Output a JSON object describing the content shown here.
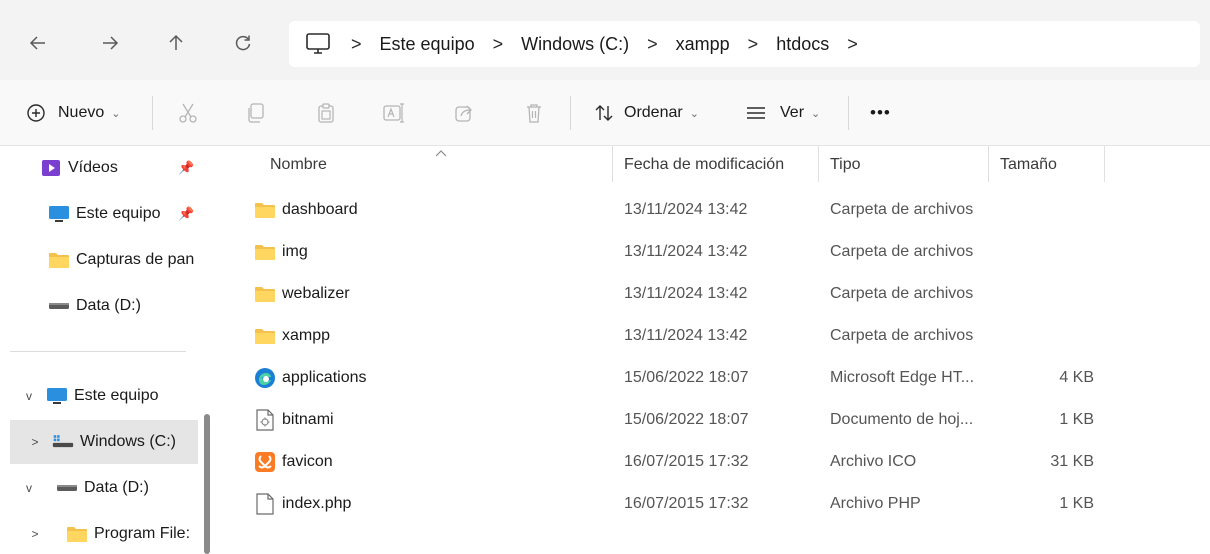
{
  "address": {
    "crumbs": [
      "Este equipo",
      "Windows (C:)",
      "xampp",
      "htdocs"
    ],
    "separator": ">"
  },
  "toolbar": {
    "new_label": "Nuevo",
    "sort_label": "Ordenar",
    "view_label": "Ver",
    "more_label": "•••"
  },
  "sidebar": {
    "quick": [
      {
        "label": "Vídeos",
        "icon": "videos-icon"
      },
      {
        "label": "Este equipo",
        "icon": "computer-icon"
      },
      {
        "label": "Capturas de pan",
        "icon": "folder-icon"
      },
      {
        "label": "Data (D:)",
        "icon": "drive-icon"
      }
    ],
    "tree": [
      {
        "label": "Este equipo",
        "expander": "v"
      },
      {
        "label": "Windows (C:)",
        "expander": ">"
      },
      {
        "label": "Data (D:)",
        "expander": "v"
      },
      {
        "label": "Program File:",
        "expander": ">"
      }
    ]
  },
  "columns": {
    "name": "Nombre",
    "date": "Fecha de modificación",
    "type": "Tipo",
    "size": "Tamaño"
  },
  "files": [
    {
      "name": "dashboard",
      "date": "13/11/2024 13:42",
      "type": "Carpeta de archivos",
      "size": "",
      "icon": "folder-icon"
    },
    {
      "name": "img",
      "date": "13/11/2024 13:42",
      "type": "Carpeta de archivos",
      "size": "",
      "icon": "folder-icon"
    },
    {
      "name": "webalizer",
      "date": "13/11/2024 13:42",
      "type": "Carpeta de archivos",
      "size": "",
      "icon": "folder-icon"
    },
    {
      "name": "xampp",
      "date": "13/11/2024 13:42",
      "type": "Carpeta de archivos",
      "size": "",
      "icon": "folder-icon"
    },
    {
      "name": "applications",
      "date": "15/06/2022 18:07",
      "type": "Microsoft Edge HT...",
      "size": "4 KB",
      "icon": "edge-icon"
    },
    {
      "name": "bitnami",
      "date": "15/06/2022 18:07",
      "type": "Documento de hoj...",
      "size": "1 KB",
      "icon": "stylesheet-file-icon"
    },
    {
      "name": "favicon",
      "date": "16/07/2015 17:32",
      "type": "Archivo ICO",
      "size": "31 KB",
      "icon": "xampp-icon"
    },
    {
      "name": "index.php",
      "date": "16/07/2015 17:32",
      "type": "Archivo PHP",
      "size": "1 KB",
      "icon": "file-icon"
    }
  ],
  "colors": {
    "folder": "#f4c14d",
    "selection": "#e5e5e5",
    "edge_blue": "#1b7fd6",
    "xampp_orange": "#fb7a24"
  }
}
